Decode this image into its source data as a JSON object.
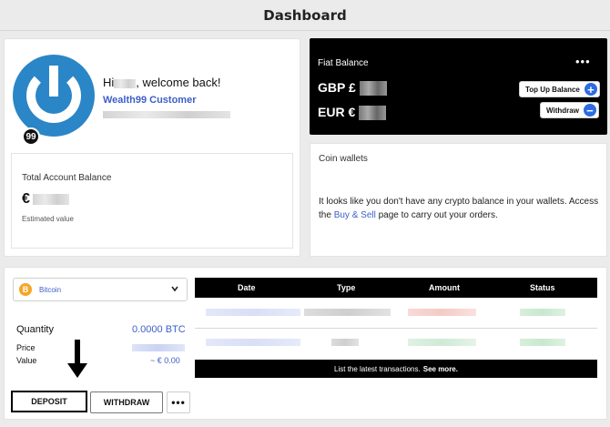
{
  "header": {
    "title": "Dashboard"
  },
  "profile": {
    "greeting_prefix": "Hi",
    "greeting_suffix": ", welcome back!",
    "customer_label": "Wealth99 Customer",
    "avatar_badge": "99",
    "total_balance_label": "Total Account Balance",
    "currency_symbol": "€",
    "estimated_label": "Estimated value"
  },
  "fiat": {
    "title": "Fiat Balance",
    "more": "•••",
    "rows": [
      {
        "currency": "GBP £"
      },
      {
        "currency": "EUR €"
      }
    ],
    "top_up_label": "Top Up Balance",
    "withdraw_label": "Withdraw"
  },
  "coin_wallets": {
    "title": "Coin wallets",
    "message_pre": "It looks like you don't have any crypto balance in your wallets. Access the ",
    "link": "Buy & Sell",
    "message_post": " page to carry out your orders."
  },
  "asset_panel": {
    "selected_asset": "Bitcoin",
    "asset_icon": "B",
    "quantity_label": "Quantity",
    "quantity_value": "0.0000 BTC",
    "price_label": "Price",
    "value_label": "Value",
    "value_value": "~ € 0.00",
    "deposit_label": "DEPOSIT",
    "withdraw_label": "WITHDRAW",
    "more_label": "•••"
  },
  "transactions": {
    "columns": [
      "Date",
      "Type",
      "Amount",
      "Status"
    ],
    "footer_text": "List the latest transactions.",
    "footer_link": "See more."
  },
  "colors": {
    "accent_blue": "#3c5fc9",
    "bitcoin_orange": "#f7a528",
    "brand_blue": "#2a86c6"
  }
}
